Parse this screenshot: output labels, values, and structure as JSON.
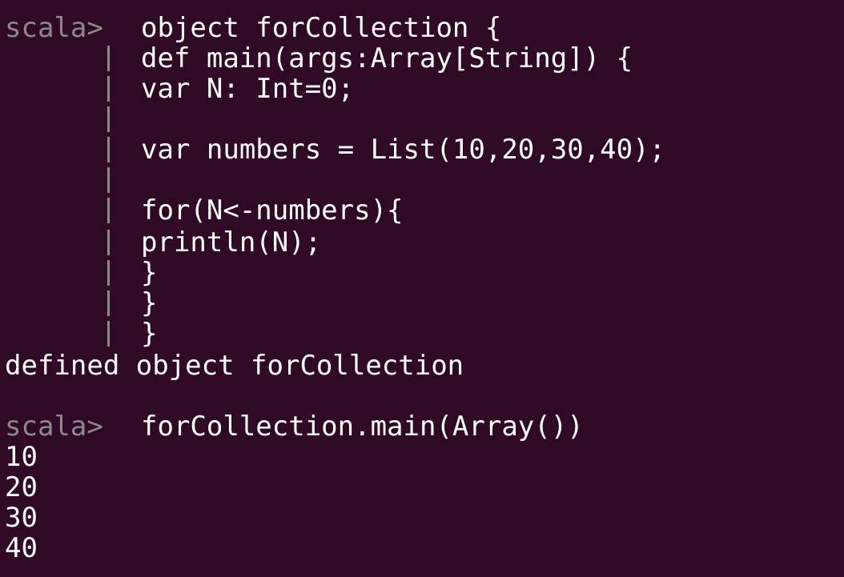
{
  "colors": {
    "background": "#300a24",
    "text": "#ffffff",
    "prompt": "#8a8a8a"
  },
  "terminal": {
    "block1": {
      "prompt": "scala>",
      "lines": [
        "object forCollection {",
        "def main(args:Array[String]) {",
        "var N: Int=0;",
        "",
        "var numbers = List(10,20,30,40);",
        "",
        "for(N<-numbers){",
        "println(N);",
        "}",
        "}",
        "}"
      ],
      "result": "defined object forCollection"
    },
    "block2": {
      "prompt": "scala>",
      "command": "forCollection.main(Array())",
      "output": [
        "10",
        "20",
        "30",
        "40"
      ]
    }
  }
}
